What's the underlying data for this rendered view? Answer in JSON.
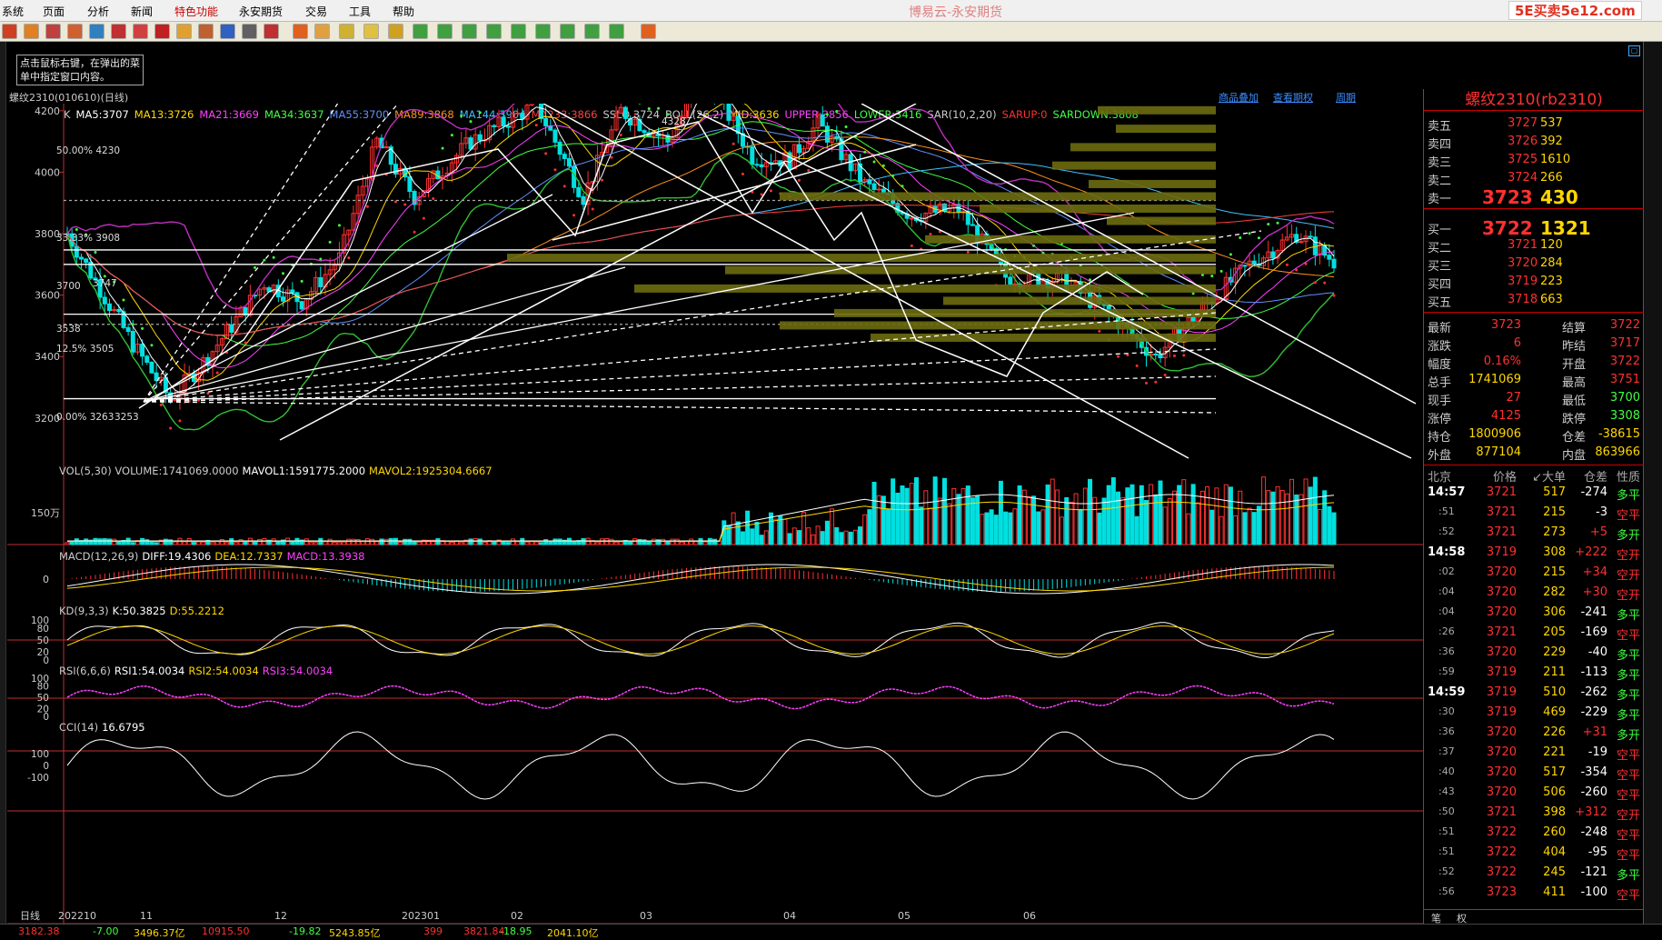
{
  "menu": {
    "items": [
      "系统",
      "页面",
      "分析",
      "新闻",
      "特色功能",
      "永安期货",
      "交易",
      "工具",
      "帮助"
    ],
    "app_title": "博易云-永安期货",
    "logo": "5E买卖5e12.com"
  },
  "tip": "点击鼠标右键，在弹出的菜单中指定窗口内容。",
  "chart": {
    "symbol": "螺纹2310(010610)(日线)",
    "links": [
      "商品叠加",
      "查看期权",
      "周期"
    ],
    "ma_legend": [
      {
        "t": "K",
        "c": "#cccccc"
      },
      {
        "t": "MA5:3707",
        "c": "#ffffff"
      },
      {
        "t": "MA13:3726",
        "c": "#ffd700"
      },
      {
        "t": "MA21:3669",
        "c": "#ff40ff"
      },
      {
        "t": "MA34:3637",
        "c": "#40ff40"
      },
      {
        "t": "MA55:3700",
        "c": "#6090ff"
      },
      {
        "t": "MA89:3868",
        "c": "#ff9020"
      },
      {
        "t": "MA144:3904",
        "c": "#40c0ff"
      },
      {
        "t": "MA233:3866",
        "c": "#ff4040"
      },
      {
        "t": "SSLO 3724",
        "c": "#cccccc"
      },
      {
        "t": "BOLL(26,2)",
        "c": "#cccccc"
      },
      {
        "t": "MID:3636",
        "c": "#ffd700"
      },
      {
        "t": "UPPER:3856",
        "c": "#ff40ff"
      },
      {
        "t": "LOWER:3416",
        "c": "#40ff40"
      },
      {
        "t": "SAR(10,2,20)",
        "c": "#cccccc"
      },
      {
        "t": "SARUP:0",
        "c": "#ff3030"
      },
      {
        "t": "SARDOWN:3808",
        "c": "#40ff40"
      }
    ],
    "y_ticks": [
      "4200",
      "4000",
      "3800",
      "3600",
      "3400",
      "3200"
    ],
    "price_labels": [
      "4328",
      "50.00%  4230",
      "33.33%  3908",
      "3700",
      "  3747",
      "3538",
      "12.5%  3505",
      "0.00%  3263",
      "3253"
    ],
    "x_labels": [
      "日线",
      "202210",
      "11",
      "12",
      "202301",
      "02",
      "03",
      "04",
      "05",
      "06"
    ]
  },
  "volume": {
    "legend": "VOL(5,30) VOLUME:1741069.0000",
    "mavol1": "MAVOL1:1591775.2000",
    "mavol2": "MAVOL2:1925304.6667",
    "ylabel": "150万"
  },
  "macd": {
    "legend": "MACD(12,26,9)",
    "diff": "DIFF:19.4306",
    "dea": "DEA:12.7337",
    "macd": "MACD:13.3938",
    "y": [
      "0"
    ]
  },
  "kd": {
    "legend": "KD(9,3,3)",
    "k": "K:50.3825",
    "d": "D:55.2212",
    "y": [
      "100",
      "80",
      "50",
      "20",
      "0"
    ]
  },
  "rsi": {
    "legend": "RSI(6,6,6)",
    "r1": "RSI1:54.0034",
    "r2": "RSI2:54.0034",
    "r3": "RSI3:54.0034",
    "y": [
      "100",
      "80",
      "50",
      "20",
      "0"
    ]
  },
  "cci": {
    "legend": "CCI(14)",
    "value": "16.6795",
    "y": [
      "100",
      "0",
      "-100"
    ]
  },
  "quote": {
    "title": "螺纹2310(rb2310)",
    "asks": [
      {
        "l": "卖五",
        "p": "3727",
        "v": "537"
      },
      {
        "l": "卖四",
        "p": "3726",
        "v": "392"
      },
      {
        "l": "卖三",
        "p": "3725",
        "v": "1610"
      },
      {
        "l": "卖二",
        "p": "3724",
        "v": "266"
      },
      {
        "l": "卖一",
        "p": "3723",
        "v": "430"
      }
    ],
    "bids": [
      {
        "l": "买一",
        "p": "3722",
        "v": "1321"
      },
      {
        "l": "买二",
        "p": "3721",
        "v": "120"
      },
      {
        "l": "买三",
        "p": "3720",
        "v": "284"
      },
      {
        "l": "买四",
        "p": "3719",
        "v": "223"
      },
      {
        "l": "买五",
        "p": "3718",
        "v": "663"
      }
    ],
    "stats": [
      [
        "最新",
        "3723",
        "结算",
        "3722"
      ],
      [
        "涨跌",
        "6",
        "昨结",
        "3717"
      ],
      [
        "幅度",
        "0.16%",
        "开盘",
        "3722"
      ],
      [
        "总手",
        "1741069",
        "最高",
        "3751"
      ],
      [
        "现手",
        "27",
        "最低",
        "3700"
      ],
      [
        "涨停",
        "4125",
        "跌停",
        "3308"
      ],
      [
        "持仓",
        "1800906",
        "仓差",
        "-38615"
      ],
      [
        "外盘",
        "877104",
        "内盘",
        "863966"
      ]
    ],
    "tick_header": [
      "北京",
      "价格",
      "↙大单",
      "仓差",
      "性质"
    ],
    "ticks": [
      [
        "14:57",
        "3721",
        "517",
        "-274",
        "多平"
      ],
      [
        ":51",
        "3721",
        "215",
        "-3",
        "空平"
      ],
      [
        ":52",
        "3721",
        "273",
        "+5",
        "多开"
      ],
      [
        "14:58",
        "3719",
        "308",
        "+222",
        "空开"
      ],
      [
        ":02",
        "3720",
        "215",
        "+34",
        "空开"
      ],
      [
        ":04",
        "3720",
        "282",
        "+30",
        "空开"
      ],
      [
        ":04",
        "3720",
        "306",
        "-241",
        "多平"
      ],
      [
        ":26",
        "3721",
        "205",
        "-169",
        "空平"
      ],
      [
        ":36",
        "3720",
        "229",
        "-40",
        "多平"
      ],
      [
        ":59",
        "3719",
        "211",
        "-113",
        "多平"
      ],
      [
        "14:59",
        "3719",
        "510",
        "-262",
        "多平"
      ],
      [
        ":30",
        "3719",
        "469",
        "-229",
        "多平"
      ],
      [
        ":36",
        "3720",
        "226",
        "+31",
        "多开"
      ],
      [
        ":37",
        "3720",
        "221",
        "-19",
        "空平"
      ],
      [
        ":40",
        "3720",
        "517",
        "-354",
        "空平"
      ],
      [
        ":43",
        "3720",
        "506",
        "-260",
        "空平"
      ],
      [
        ":50",
        "3721",
        "398",
        "+312",
        "空开"
      ],
      [
        ":51",
        "3722",
        "260",
        "-248",
        "空平"
      ],
      [
        ":51",
        "3722",
        "404",
        "-95",
        "空平"
      ],
      [
        ":52",
        "3722",
        "245",
        "-121",
        "多平"
      ],
      [
        ":56",
        "3723",
        "411",
        "-100",
        "空平"
      ]
    ],
    "tabs": [
      "笔",
      "权"
    ]
  },
  "status": [
    {
      "t": "3182.38",
      "c": "#ff3030"
    },
    {
      "t": "-7.00",
      "c": "#40ff40"
    },
    {
      "t": "3496.37亿",
      "c": "#ffd700"
    },
    {
      "t": "10915.50",
      "c": "#ff3030"
    },
    {
      "t": "-19.82",
      "c": "#40ff40"
    },
    {
      "t": "5243.85亿",
      "c": "#ffd700"
    },
    {
      "t": "399",
      "c": "#ff3030"
    },
    {
      "t": "3821.84",
      "c": "#ff3030"
    },
    {
      "t": "-18.95",
      "c": "#40ff40"
    },
    {
      "t": "2041.10亿",
      "c": "#ffd700"
    }
  ]
}
